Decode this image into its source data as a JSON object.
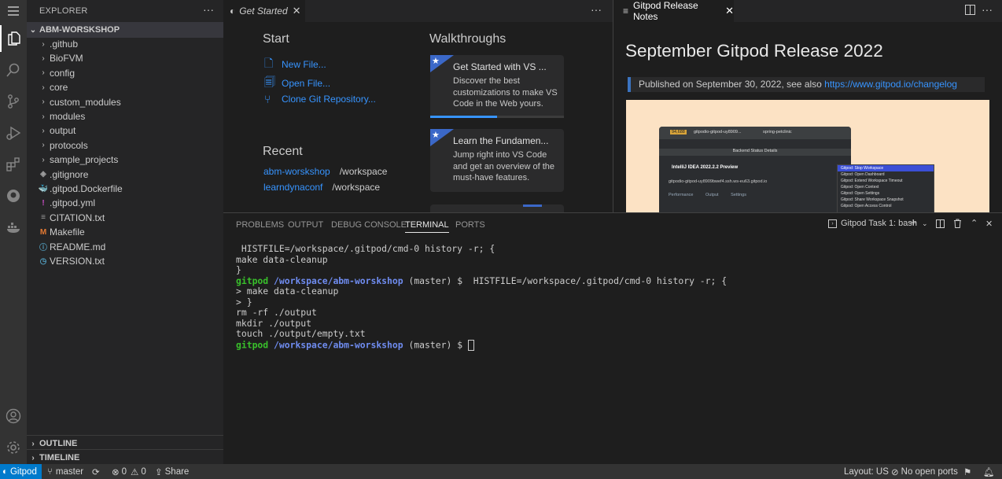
{
  "sidebar": {
    "title": "EXPLORER",
    "more": "···",
    "root": "ABM-WORSKSHOP",
    "items": [
      {
        "label": ".github",
        "kind": "folder"
      },
      {
        "label": "BioFVM",
        "kind": "folder"
      },
      {
        "label": "config",
        "kind": "folder"
      },
      {
        "label": "core",
        "kind": "folder"
      },
      {
        "label": "custom_modules",
        "kind": "folder"
      },
      {
        "label": "modules",
        "kind": "folder"
      },
      {
        "label": "output",
        "kind": "folder"
      },
      {
        "label": "protocols",
        "kind": "folder"
      },
      {
        "label": "sample_projects",
        "kind": "folder"
      },
      {
        "label": ".gitignore",
        "kind": "file",
        "icon": "◈"
      },
      {
        "label": ".gitpod.Dockerfile",
        "kind": "file",
        "icon": "🐳"
      },
      {
        "label": ".gitpod.yml",
        "kind": "file",
        "icon": "!"
      },
      {
        "label": "CITATION.txt",
        "kind": "file",
        "icon": "≡"
      },
      {
        "label": "Makefile",
        "kind": "file",
        "icon": "M"
      },
      {
        "label": "README.md",
        "kind": "file",
        "icon": "ⓘ"
      },
      {
        "label": "VERSION.txt",
        "kind": "file",
        "icon": "◷"
      }
    ],
    "outline": "OUTLINE",
    "timeline": "TIMELINE"
  },
  "editor_left": {
    "tab_label": "Get Started",
    "more": "···",
    "start_heading": "Start",
    "start_links": [
      "New File...",
      "Open File...",
      "Clone Git Repository..."
    ],
    "recent_heading": "Recent",
    "recent": [
      {
        "name": "abm-worskshop",
        "path": "/workspace"
      },
      {
        "name": "learndynaconf",
        "path": "/workspace"
      }
    ],
    "walkthroughs_heading": "Walkthroughs",
    "walkthroughs": [
      {
        "title": "Get Started with VS ...",
        "desc": "Discover the best customizations to make VS Code in the Web yours.",
        "progress": 0.5
      },
      {
        "title": "Learn the Fundamen...",
        "desc": "Jump right into VS Code and get an overview of the must-have features."
      }
    ]
  },
  "editor_right": {
    "tab_label": "Gitpod Release Notes",
    "title": "September Gitpod Release 2022",
    "published_prefix": "Published on September 30, 2022, see also ",
    "published_link": "https://www.gitpod.io/changelog",
    "image": {
      "badge": "94,688",
      "workspace": "gitpodio-gitpod-uy8909...",
      "project": "spring-petclinic",
      "status_header": "Backend Status Details",
      "ide": "IntelliJ IDEA 2022.2.2 Preview",
      "host": "gitpodio-gitpod-uy8909bwef4.ssh.ws-eu63.gitpod.io",
      "tabs": [
        "Performance",
        "Output",
        "Settings"
      ],
      "menu": [
        "Gitpod: Stop Workspace",
        "Gitpod: Open Dashboard",
        "Gitpod: Extend Workspace Timeout",
        "Gitpod: Open Context",
        "Gitpod: Open Settings",
        "Gitpod: Share Workspace Snapshot",
        "Gitpod: Open Access Control"
      ]
    }
  },
  "panel": {
    "tabs": [
      "PROBLEMS",
      "OUTPUT",
      "DEBUG CONSOLE",
      "TERMINAL",
      "PORTS"
    ],
    "active_tab": "TERMINAL",
    "terminal_name": "Gitpod Task 1: bash",
    "lines": [
      " HISTFILE=/workspace/.gitpod/cmd-0 history -r; {",
      "make data-cleanup",
      "}",
      "> make data-cleanup",
      "> }",
      "rm -rf ./output",
      "mkdir ./output",
      "touch ./output/empty.txt"
    ],
    "prompt_user": "gitpod",
    "prompt_path": "/workspace/abm-worskshop",
    "prompt_branch": "(master) $",
    "prompt_cmd": " HISTFILE=/workspace/.gitpod/cmd-0 history -r; {"
  },
  "status": {
    "remote": "Gitpod",
    "branch": "master",
    "errors": "0",
    "warnings": "0",
    "share": "Share",
    "layout": "Layout: US",
    "ports": "No open ports"
  },
  "colors": {
    "accent": "#007acc",
    "link": "#3794ff",
    "prompt_user": "#39c02b",
    "prompt_path": "#6f8cf0"
  }
}
